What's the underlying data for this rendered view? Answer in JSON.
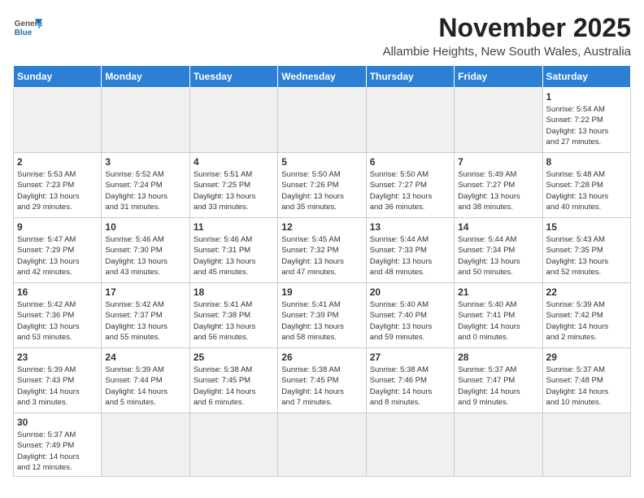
{
  "header": {
    "logo_general": "General",
    "logo_blue": "Blue",
    "month": "November 2025",
    "location": "Allambie Heights, New South Wales, Australia"
  },
  "days_of_week": [
    "Sunday",
    "Monday",
    "Tuesday",
    "Wednesday",
    "Thursday",
    "Friday",
    "Saturday"
  ],
  "weeks": [
    [
      {
        "day": "",
        "detail": ""
      },
      {
        "day": "",
        "detail": ""
      },
      {
        "day": "",
        "detail": ""
      },
      {
        "day": "",
        "detail": ""
      },
      {
        "day": "",
        "detail": ""
      },
      {
        "day": "",
        "detail": ""
      },
      {
        "day": "1",
        "detail": "Sunrise: 5:54 AM\nSunset: 7:22 PM\nDaylight: 13 hours\nand 27 minutes."
      }
    ],
    [
      {
        "day": "2",
        "detail": "Sunrise: 5:53 AM\nSunset: 7:23 PM\nDaylight: 13 hours\nand 29 minutes."
      },
      {
        "day": "3",
        "detail": "Sunrise: 5:52 AM\nSunset: 7:24 PM\nDaylight: 13 hours\nand 31 minutes."
      },
      {
        "day": "4",
        "detail": "Sunrise: 5:51 AM\nSunset: 7:25 PM\nDaylight: 13 hours\nand 33 minutes."
      },
      {
        "day": "5",
        "detail": "Sunrise: 5:50 AM\nSunset: 7:26 PM\nDaylight: 13 hours\nand 35 minutes."
      },
      {
        "day": "6",
        "detail": "Sunrise: 5:50 AM\nSunset: 7:27 PM\nDaylight: 13 hours\nand 36 minutes."
      },
      {
        "day": "7",
        "detail": "Sunrise: 5:49 AM\nSunset: 7:27 PM\nDaylight: 13 hours\nand 38 minutes."
      },
      {
        "day": "8",
        "detail": "Sunrise: 5:48 AM\nSunset: 7:28 PM\nDaylight: 13 hours\nand 40 minutes."
      }
    ],
    [
      {
        "day": "9",
        "detail": "Sunrise: 5:47 AM\nSunset: 7:29 PM\nDaylight: 13 hours\nand 42 minutes."
      },
      {
        "day": "10",
        "detail": "Sunrise: 5:46 AM\nSunset: 7:30 PM\nDaylight: 13 hours\nand 43 minutes."
      },
      {
        "day": "11",
        "detail": "Sunrise: 5:46 AM\nSunset: 7:31 PM\nDaylight: 13 hours\nand 45 minutes."
      },
      {
        "day": "12",
        "detail": "Sunrise: 5:45 AM\nSunset: 7:32 PM\nDaylight: 13 hours\nand 47 minutes."
      },
      {
        "day": "13",
        "detail": "Sunrise: 5:44 AM\nSunset: 7:33 PM\nDaylight: 13 hours\nand 48 minutes."
      },
      {
        "day": "14",
        "detail": "Sunrise: 5:44 AM\nSunset: 7:34 PM\nDaylight: 13 hours\nand 50 minutes."
      },
      {
        "day": "15",
        "detail": "Sunrise: 5:43 AM\nSunset: 7:35 PM\nDaylight: 13 hours\nand 52 minutes."
      }
    ],
    [
      {
        "day": "16",
        "detail": "Sunrise: 5:42 AM\nSunset: 7:36 PM\nDaylight: 13 hours\nand 53 minutes."
      },
      {
        "day": "17",
        "detail": "Sunrise: 5:42 AM\nSunset: 7:37 PM\nDaylight: 13 hours\nand 55 minutes."
      },
      {
        "day": "18",
        "detail": "Sunrise: 5:41 AM\nSunset: 7:38 PM\nDaylight: 13 hours\nand 56 minutes."
      },
      {
        "day": "19",
        "detail": "Sunrise: 5:41 AM\nSunset: 7:39 PM\nDaylight: 13 hours\nand 58 minutes."
      },
      {
        "day": "20",
        "detail": "Sunrise: 5:40 AM\nSunset: 7:40 PM\nDaylight: 13 hours\nand 59 minutes."
      },
      {
        "day": "21",
        "detail": "Sunrise: 5:40 AM\nSunset: 7:41 PM\nDaylight: 14 hours\nand 0 minutes."
      },
      {
        "day": "22",
        "detail": "Sunrise: 5:39 AM\nSunset: 7:42 PM\nDaylight: 14 hours\nand 2 minutes."
      }
    ],
    [
      {
        "day": "23",
        "detail": "Sunrise: 5:39 AM\nSunset: 7:43 PM\nDaylight: 14 hours\nand 3 minutes."
      },
      {
        "day": "24",
        "detail": "Sunrise: 5:39 AM\nSunset: 7:44 PM\nDaylight: 14 hours\nand 5 minutes."
      },
      {
        "day": "25",
        "detail": "Sunrise: 5:38 AM\nSunset: 7:45 PM\nDaylight: 14 hours\nand 6 minutes."
      },
      {
        "day": "26",
        "detail": "Sunrise: 5:38 AM\nSunset: 7:45 PM\nDaylight: 14 hours\nand 7 minutes."
      },
      {
        "day": "27",
        "detail": "Sunrise: 5:38 AM\nSunset: 7:46 PM\nDaylight: 14 hours\nand 8 minutes."
      },
      {
        "day": "28",
        "detail": "Sunrise: 5:37 AM\nSunset: 7:47 PM\nDaylight: 14 hours\nand 9 minutes."
      },
      {
        "day": "29",
        "detail": "Sunrise: 5:37 AM\nSunset: 7:48 PM\nDaylight: 14 hours\nand 10 minutes."
      }
    ],
    [
      {
        "day": "30",
        "detail": "Sunrise: 5:37 AM\nSunset: 7:49 PM\nDaylight: 14 hours\nand 12 minutes."
      },
      {
        "day": "",
        "detail": ""
      },
      {
        "day": "",
        "detail": ""
      },
      {
        "day": "",
        "detail": ""
      },
      {
        "day": "",
        "detail": ""
      },
      {
        "day": "",
        "detail": ""
      },
      {
        "day": "",
        "detail": ""
      }
    ]
  ]
}
